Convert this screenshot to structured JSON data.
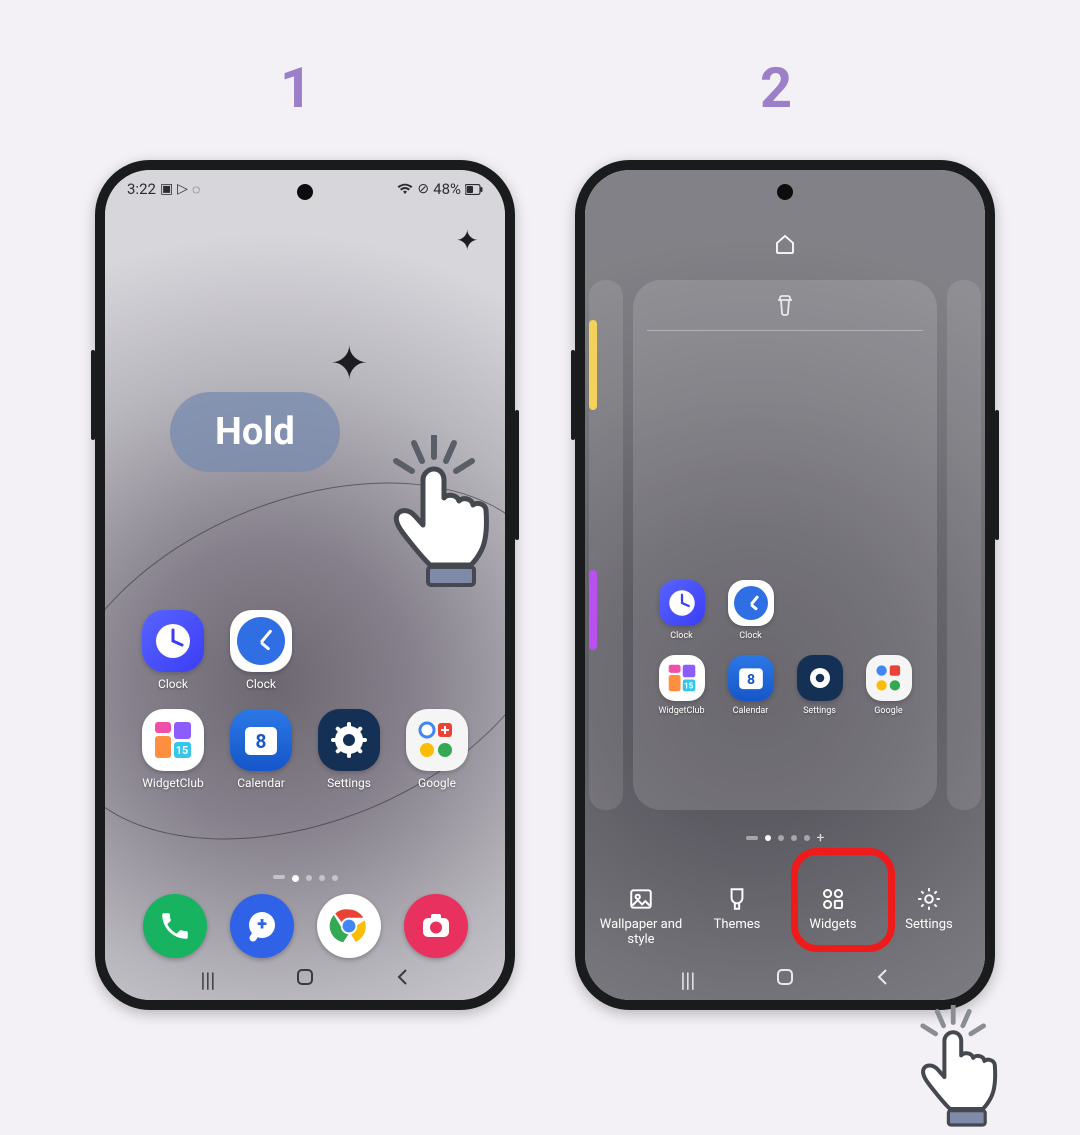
{
  "steps": {
    "one": "1",
    "two": "2"
  },
  "status": {
    "time": "3:22",
    "battery": "48%"
  },
  "hold_label": "Hold",
  "phone1_apps_row1": [
    {
      "label": "Clock"
    },
    {
      "label": "Clock"
    }
  ],
  "phone1_apps_row2": [
    {
      "label": "WidgetClub"
    },
    {
      "label": "Calendar",
      "day": "8"
    },
    {
      "label": "Settings"
    },
    {
      "label": "Google"
    }
  ],
  "phone2_apps_row1": [
    {
      "label": "Clock"
    },
    {
      "label": "Clock"
    }
  ],
  "phone2_apps_row2": [
    {
      "label": "WidgetClub"
    },
    {
      "label": "Calendar",
      "day": "8"
    },
    {
      "label": "Settings"
    },
    {
      "label": "Google"
    }
  ],
  "edit_options": {
    "wallpaper": "Wallpaper and style",
    "themes": "Themes",
    "widgets": "Widgets",
    "settings": "Settings"
  }
}
